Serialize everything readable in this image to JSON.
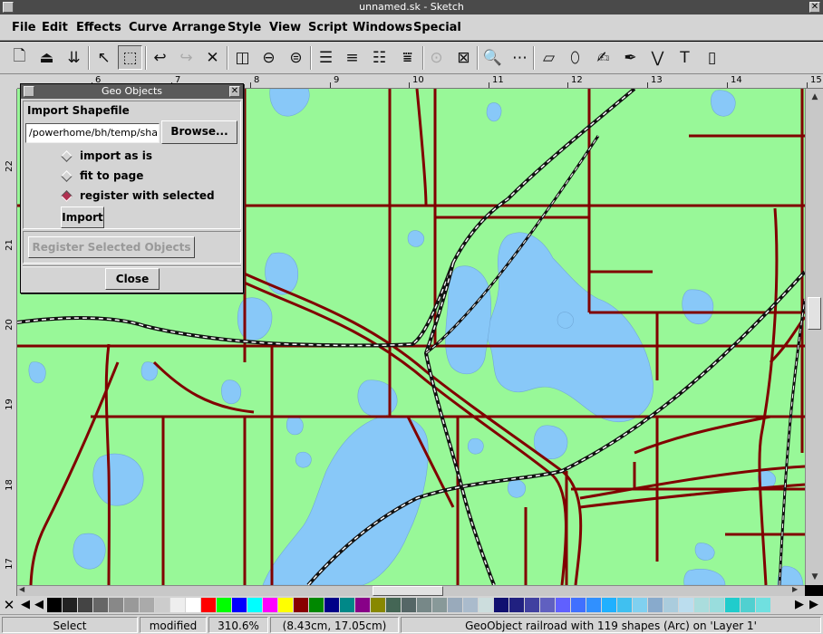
{
  "window": {
    "title": "unnamed.sk - Sketch",
    "close_glyph": "✕"
  },
  "menu": [
    "File",
    "Edit",
    "Effects",
    "Curve",
    "Arrange",
    "Style",
    "View",
    "Script",
    "Windows",
    "Special"
  ],
  "toolbar": [
    {
      "icon": "new-document-icon",
      "glyph": "🗋"
    },
    {
      "icon": "open-icon",
      "glyph": "⏏"
    },
    {
      "icon": "save-icon",
      "glyph": "⇊"
    },
    {
      "icon": "edit-nodes-icon",
      "glyph": "↖"
    },
    {
      "icon": "select-icon",
      "glyph": "⬚",
      "active": true
    },
    {
      "icon": "undo-icon",
      "glyph": "↩"
    },
    {
      "icon": "redo-icon",
      "glyph": "↪",
      "disabled": true
    },
    {
      "icon": "delete-icon",
      "glyph": "✕"
    },
    {
      "icon": "flip-horizontal-icon",
      "glyph": "◫"
    },
    {
      "icon": "flip-vertical-icon",
      "glyph": "⊖"
    },
    {
      "icon": "rotate-icon",
      "glyph": "⊜"
    },
    {
      "icon": "align-left-icon",
      "glyph": "☰"
    },
    {
      "icon": "align-center-icon",
      "glyph": "≡"
    },
    {
      "icon": "align-right-icon",
      "glyph": "☷"
    },
    {
      "icon": "align-bottom-icon",
      "glyph": "⩸"
    },
    {
      "icon": "group-icon",
      "glyph": "⊙",
      "disabled": true
    },
    {
      "icon": "ungroup-icon",
      "glyph": "⊠"
    },
    {
      "icon": "zoom-icon",
      "glyph": "🔍"
    },
    {
      "icon": "grid-icon",
      "glyph": "⋯"
    },
    {
      "icon": "rectangle-tool-icon",
      "glyph": "▱"
    },
    {
      "icon": "ellipse-tool-icon",
      "glyph": "⬯"
    },
    {
      "icon": "freehand-tool-icon",
      "glyph": "✍"
    },
    {
      "icon": "pen-tool-icon",
      "glyph": "✒"
    },
    {
      "icon": "polyline-tool-icon",
      "glyph": "⋁"
    },
    {
      "icon": "text-tool-icon",
      "glyph": "T"
    },
    {
      "icon": "image-tool-icon",
      "glyph": "▯"
    }
  ],
  "ruler_top": [
    "6",
    "7",
    "8",
    "9",
    "10",
    "11",
    "12",
    "13",
    "14",
    "15"
  ],
  "ruler_left": [
    "22",
    "21",
    "20",
    "19",
    "18",
    "17"
  ],
  "dialog": {
    "title": "Geo Objects",
    "section_label": "Import Shapefile",
    "path_value": "/powerhome/bh/temp/sha",
    "browse_label": "Browse...",
    "options": [
      {
        "label": "import as is",
        "selected": false
      },
      {
        "label": "fit to page",
        "selected": false
      },
      {
        "label": "register with selected",
        "selected": true
      }
    ],
    "import_label": "Import",
    "register_label": "Register Selected Objects",
    "close_label": "Close"
  },
  "palette": {
    "none_glyph": "✕",
    "left_arrow": "◀",
    "right_arrow": "▶",
    "colors": [
      "#000000",
      "#222222",
      "#444444",
      "#666666",
      "#888888",
      "#999999",
      "#aaaaaa",
      "#cccccc",
      "#eeeeee",
      "#ffffff",
      "#ff0000",
      "#00ff00",
      "#0000ff",
      "#00ffff",
      "#ff00ff",
      "#ffff00",
      "#880000",
      "#008800",
      "#000088",
      "#008888",
      "#880088",
      "#888800",
      "#446655",
      "#556666",
      "#778888",
      "#889999",
      "#99aabb",
      "#aabbcc",
      "#ccdddd",
      "#101070",
      "#202080",
      "#4040a0",
      "#6060c0",
      "#6060ff",
      "#4070ff",
      "#3090ff",
      "#20b0ff",
      "#40c0f0",
      "#80d0f0",
      "#88aacc",
      "#aaccdd",
      "#bbddee",
      "#aadddd",
      "#99dddd",
      "#20cccc",
      "#50d0d0",
      "#70e0e0"
    ]
  },
  "status": {
    "mode": "Select",
    "doc_state": "modified",
    "zoom": "310.6%",
    "coords": "(8.43cm, 17.05cm)",
    "selection": "GeoObject railroad with 119 shapes (Arc) on 'Layer 1'"
  },
  "colors": {
    "land": "#98f898",
    "water": "#88c8f8",
    "roads": "#800000"
  }
}
